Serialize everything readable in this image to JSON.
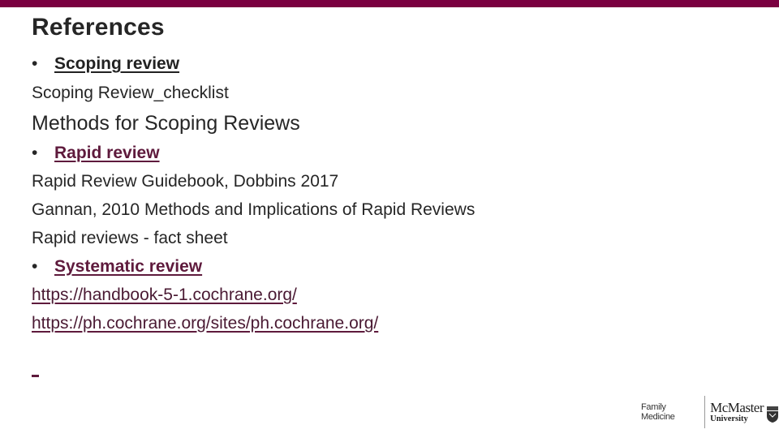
{
  "slide": {
    "title": "References",
    "accent_color": "#7a0040",
    "link_color": "#5e1a3c"
  },
  "sections": {
    "scoping": {
      "bullet": "•",
      "heading": "Scoping review",
      "items": [
        "Scoping Review_checklist",
        "Methods for Scoping Reviews"
      ]
    },
    "rapid": {
      "bullet": "•",
      "heading": "Rapid review",
      "items": [
        "Rapid Review Guidebook, Dobbins 2017",
        "Gannan, 2010 Methods and Implications of Rapid Reviews",
        "Rapid reviews - fact sheet"
      ]
    },
    "systematic": {
      "bullet": "•",
      "heading": "Systematic review",
      "links": [
        "https://handbook-5-1.cochrane.org/",
        "https://ph.cochrane.org/sites/ph.cochrane.org/"
      ]
    }
  },
  "footer": {
    "department": "Family Medicine",
    "university_name": "McMaster",
    "university_sub": "University"
  }
}
